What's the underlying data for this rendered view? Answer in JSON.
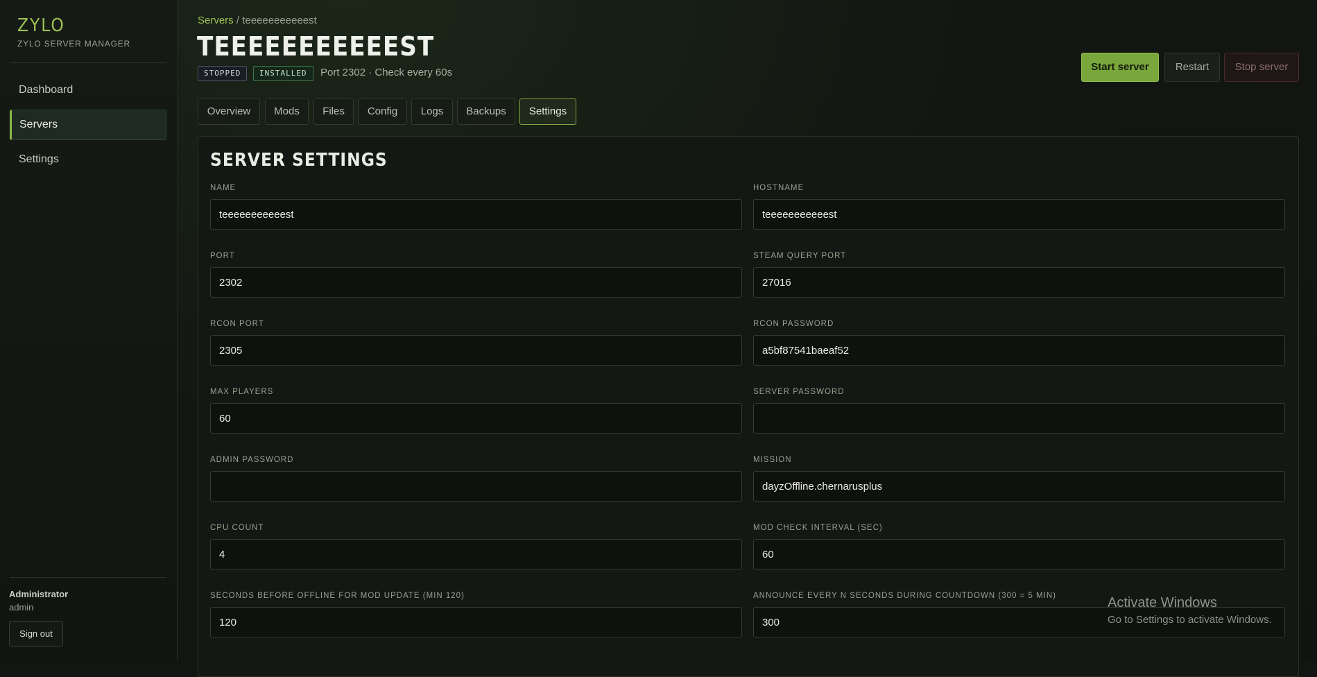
{
  "brand": {
    "name": "ZYLO",
    "subtitle": "ZYLO SERVER MANAGER"
  },
  "sidebar": {
    "items": [
      {
        "label": "Dashboard",
        "active": false
      },
      {
        "label": "Servers",
        "active": true
      },
      {
        "label": "Settings",
        "active": false
      }
    ],
    "user": {
      "role": "Administrator",
      "username": "admin"
    },
    "sign_out_label": "Sign out"
  },
  "breadcrumb": {
    "root": "Servers",
    "separator": "/",
    "current": "teeeeeeeeeeest"
  },
  "server": {
    "title": "TEEEEEEEEEEEST",
    "badges": [
      "STOPPED",
      "INSTALLED"
    ],
    "meta": "Port 2302 · Check every 60s"
  },
  "actions": {
    "start": "Start server",
    "restart": "Restart",
    "stop": "Stop server"
  },
  "tabs": [
    {
      "label": "Overview",
      "active": false
    },
    {
      "label": "Mods",
      "active": false
    },
    {
      "label": "Files",
      "active": false
    },
    {
      "label": "Config",
      "active": false
    },
    {
      "label": "Logs",
      "active": false
    },
    {
      "label": "Backups",
      "active": false
    },
    {
      "label": "Settings",
      "active": true
    }
  ],
  "settings": {
    "title": "SERVER SETTINGS",
    "fields": [
      {
        "label": "NAME",
        "value": "teeeeeeeeeeest"
      },
      {
        "label": "HOSTNAME",
        "value": "teeeeeeeeeeest"
      },
      {
        "label": "PORT",
        "value": "2302"
      },
      {
        "label": "STEAM QUERY PORT",
        "value": "27016"
      },
      {
        "label": "RCON PORT",
        "value": "2305"
      },
      {
        "label": "RCON PASSWORD",
        "value": "a5bf87541baeaf52"
      },
      {
        "label": "MAX PLAYERS",
        "value": "60"
      },
      {
        "label": "SERVER PASSWORD",
        "value": ""
      },
      {
        "label": "ADMIN PASSWORD",
        "value": ""
      },
      {
        "label": "MISSION",
        "value": "dayzOffline.chernarusplus"
      },
      {
        "label": "CPU COUNT",
        "value": "4"
      },
      {
        "label": "MOD CHECK INTERVAL (SEC)",
        "value": "60"
      },
      {
        "label": "SECONDS BEFORE OFFLINE FOR MOD UPDATE (MIN 120)",
        "value": "120"
      },
      {
        "label": "ANNOUNCE EVERY N SECONDS DURING COUNTDOWN (300 = 5 MIN)",
        "value": "300"
      }
    ]
  },
  "watermark": {
    "line1": "Activate Windows",
    "line2": "Go to Settings to activate Windows."
  },
  "colors": {
    "accent": "#8cb84a",
    "background": "#121512",
    "stop": "#8d6e68"
  }
}
